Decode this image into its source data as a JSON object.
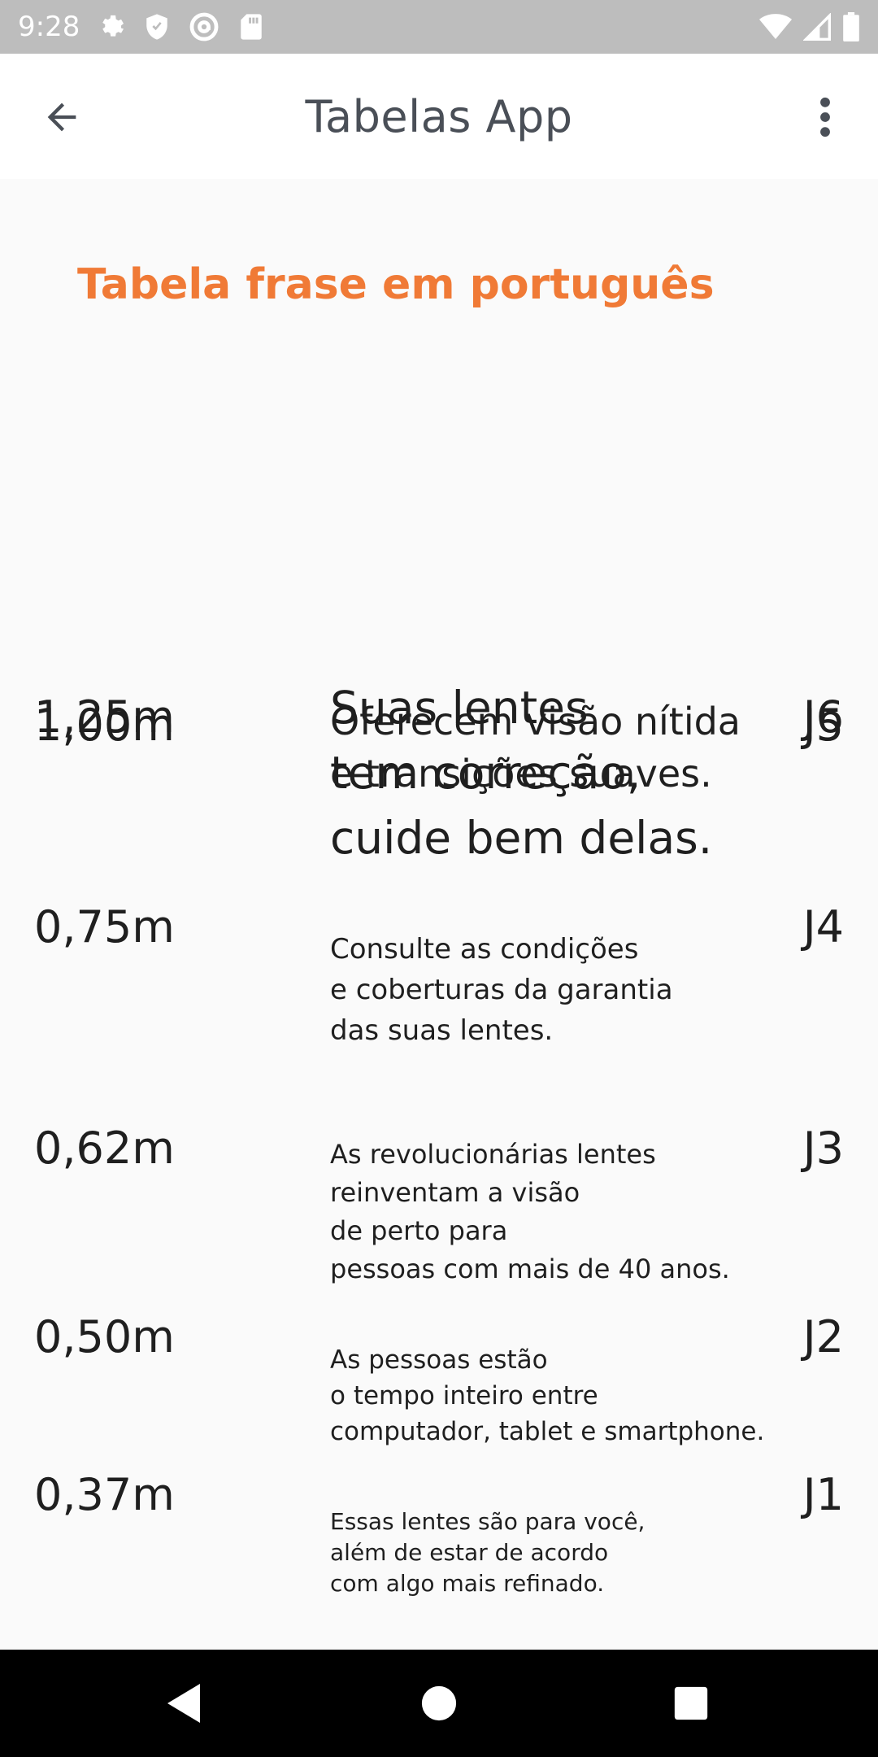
{
  "status_bar": {
    "time": "9:28",
    "left_icons": [
      "gear-icon",
      "shield-icon",
      "at-sync-icon",
      "sd-card-icon"
    ],
    "right_icons": [
      "wifi-icon",
      "cell-signal-icon",
      "battery-icon"
    ]
  },
  "app_bar": {
    "title": "Tabelas App",
    "back_icon": "arrow-back-icon",
    "menu_icon": "more-vert-icon"
  },
  "section_title": "Tabela frase em português",
  "rows": [
    {
      "distance": "1,25m",
      "phrase": "Suas lentes\ntem correção,\ncuide bem delas.",
      "code": "J6"
    },
    {
      "distance": "1,00m",
      "phrase": "Oferecem visão nítida\ne transições suaves.",
      "code": "J5"
    },
    {
      "distance": "0,75m",
      "phrase": "Consulte as condições\ne coberturas da garantia\ndas suas lentes.",
      "code": "J4"
    },
    {
      "distance": "0,62m",
      "phrase": " As revolucionárias lentes\n reinventam a visão\nde perto para\n pessoas com mais de 40 anos.",
      "code": "J3"
    },
    {
      "distance": "0,50m",
      "phrase": " As pessoas estão\n o tempo inteiro entre\n computador, tablet e smartphone.",
      "code": "J2"
    },
    {
      "distance": "0,37m",
      "phrase": "Essas lentes são para você,\nalém de estar de acordo\n com algo mais refinado.",
      "code": "J1"
    }
  ],
  "nav_bar": {
    "icons": [
      "back-triangle-icon",
      "home-circle-icon",
      "recents-square-icon"
    ]
  },
  "colors": {
    "accent": "#f07a36",
    "status_bar": "#bdbdbd",
    "background": "#fafafa",
    "nav_bar": "#000000"
  }
}
